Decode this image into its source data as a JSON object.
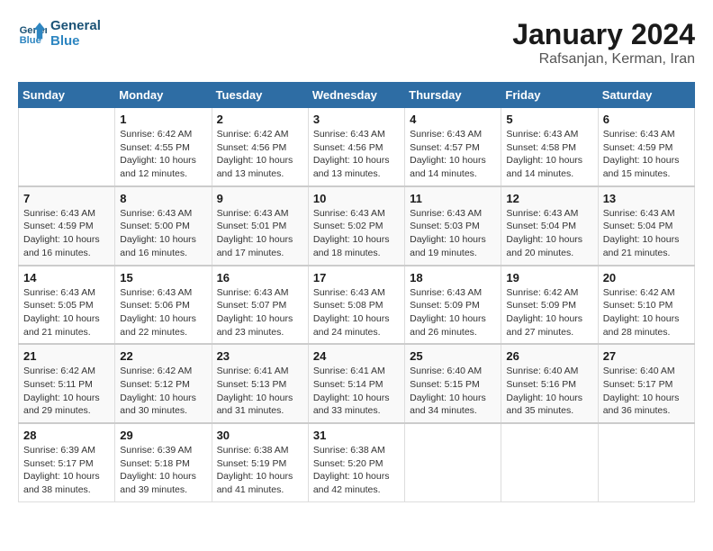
{
  "logo": {
    "line1": "General",
    "line2": "Blue"
  },
  "title": "January 2024",
  "location": "Rafsanjan, Kerman, Iran",
  "weekdays": [
    "Sunday",
    "Monday",
    "Tuesday",
    "Wednesday",
    "Thursday",
    "Friday",
    "Saturday"
  ],
  "weeks": [
    [
      {
        "day": "",
        "info": ""
      },
      {
        "day": "1",
        "info": "Sunrise: 6:42 AM\nSunset: 4:55 PM\nDaylight: 10 hours\nand 12 minutes."
      },
      {
        "day": "2",
        "info": "Sunrise: 6:42 AM\nSunset: 4:56 PM\nDaylight: 10 hours\nand 13 minutes."
      },
      {
        "day": "3",
        "info": "Sunrise: 6:43 AM\nSunset: 4:56 PM\nDaylight: 10 hours\nand 13 minutes."
      },
      {
        "day": "4",
        "info": "Sunrise: 6:43 AM\nSunset: 4:57 PM\nDaylight: 10 hours\nand 14 minutes."
      },
      {
        "day": "5",
        "info": "Sunrise: 6:43 AM\nSunset: 4:58 PM\nDaylight: 10 hours\nand 14 minutes."
      },
      {
        "day": "6",
        "info": "Sunrise: 6:43 AM\nSunset: 4:59 PM\nDaylight: 10 hours\nand 15 minutes."
      }
    ],
    [
      {
        "day": "7",
        "info": "Sunrise: 6:43 AM\nSunset: 4:59 PM\nDaylight: 10 hours\nand 16 minutes."
      },
      {
        "day": "8",
        "info": "Sunrise: 6:43 AM\nSunset: 5:00 PM\nDaylight: 10 hours\nand 16 minutes."
      },
      {
        "day": "9",
        "info": "Sunrise: 6:43 AM\nSunset: 5:01 PM\nDaylight: 10 hours\nand 17 minutes."
      },
      {
        "day": "10",
        "info": "Sunrise: 6:43 AM\nSunset: 5:02 PM\nDaylight: 10 hours\nand 18 minutes."
      },
      {
        "day": "11",
        "info": "Sunrise: 6:43 AM\nSunset: 5:03 PM\nDaylight: 10 hours\nand 19 minutes."
      },
      {
        "day": "12",
        "info": "Sunrise: 6:43 AM\nSunset: 5:04 PM\nDaylight: 10 hours\nand 20 minutes."
      },
      {
        "day": "13",
        "info": "Sunrise: 6:43 AM\nSunset: 5:04 PM\nDaylight: 10 hours\nand 21 minutes."
      }
    ],
    [
      {
        "day": "14",
        "info": "Sunrise: 6:43 AM\nSunset: 5:05 PM\nDaylight: 10 hours\nand 21 minutes."
      },
      {
        "day": "15",
        "info": "Sunrise: 6:43 AM\nSunset: 5:06 PM\nDaylight: 10 hours\nand 22 minutes."
      },
      {
        "day": "16",
        "info": "Sunrise: 6:43 AM\nSunset: 5:07 PM\nDaylight: 10 hours\nand 23 minutes."
      },
      {
        "day": "17",
        "info": "Sunrise: 6:43 AM\nSunset: 5:08 PM\nDaylight: 10 hours\nand 24 minutes."
      },
      {
        "day": "18",
        "info": "Sunrise: 6:43 AM\nSunset: 5:09 PM\nDaylight: 10 hours\nand 26 minutes."
      },
      {
        "day": "19",
        "info": "Sunrise: 6:42 AM\nSunset: 5:09 PM\nDaylight: 10 hours\nand 27 minutes."
      },
      {
        "day": "20",
        "info": "Sunrise: 6:42 AM\nSunset: 5:10 PM\nDaylight: 10 hours\nand 28 minutes."
      }
    ],
    [
      {
        "day": "21",
        "info": "Sunrise: 6:42 AM\nSunset: 5:11 PM\nDaylight: 10 hours\nand 29 minutes."
      },
      {
        "day": "22",
        "info": "Sunrise: 6:42 AM\nSunset: 5:12 PM\nDaylight: 10 hours\nand 30 minutes."
      },
      {
        "day": "23",
        "info": "Sunrise: 6:41 AM\nSunset: 5:13 PM\nDaylight: 10 hours\nand 31 minutes."
      },
      {
        "day": "24",
        "info": "Sunrise: 6:41 AM\nSunset: 5:14 PM\nDaylight: 10 hours\nand 33 minutes."
      },
      {
        "day": "25",
        "info": "Sunrise: 6:40 AM\nSunset: 5:15 PM\nDaylight: 10 hours\nand 34 minutes."
      },
      {
        "day": "26",
        "info": "Sunrise: 6:40 AM\nSunset: 5:16 PM\nDaylight: 10 hours\nand 35 minutes."
      },
      {
        "day": "27",
        "info": "Sunrise: 6:40 AM\nSunset: 5:17 PM\nDaylight: 10 hours\nand 36 minutes."
      }
    ],
    [
      {
        "day": "28",
        "info": "Sunrise: 6:39 AM\nSunset: 5:17 PM\nDaylight: 10 hours\nand 38 minutes."
      },
      {
        "day": "29",
        "info": "Sunrise: 6:39 AM\nSunset: 5:18 PM\nDaylight: 10 hours\nand 39 minutes."
      },
      {
        "day": "30",
        "info": "Sunrise: 6:38 AM\nSunset: 5:19 PM\nDaylight: 10 hours\nand 41 minutes."
      },
      {
        "day": "31",
        "info": "Sunrise: 6:38 AM\nSunset: 5:20 PM\nDaylight: 10 hours\nand 42 minutes."
      },
      {
        "day": "",
        "info": ""
      },
      {
        "day": "",
        "info": ""
      },
      {
        "day": "",
        "info": ""
      }
    ]
  ]
}
